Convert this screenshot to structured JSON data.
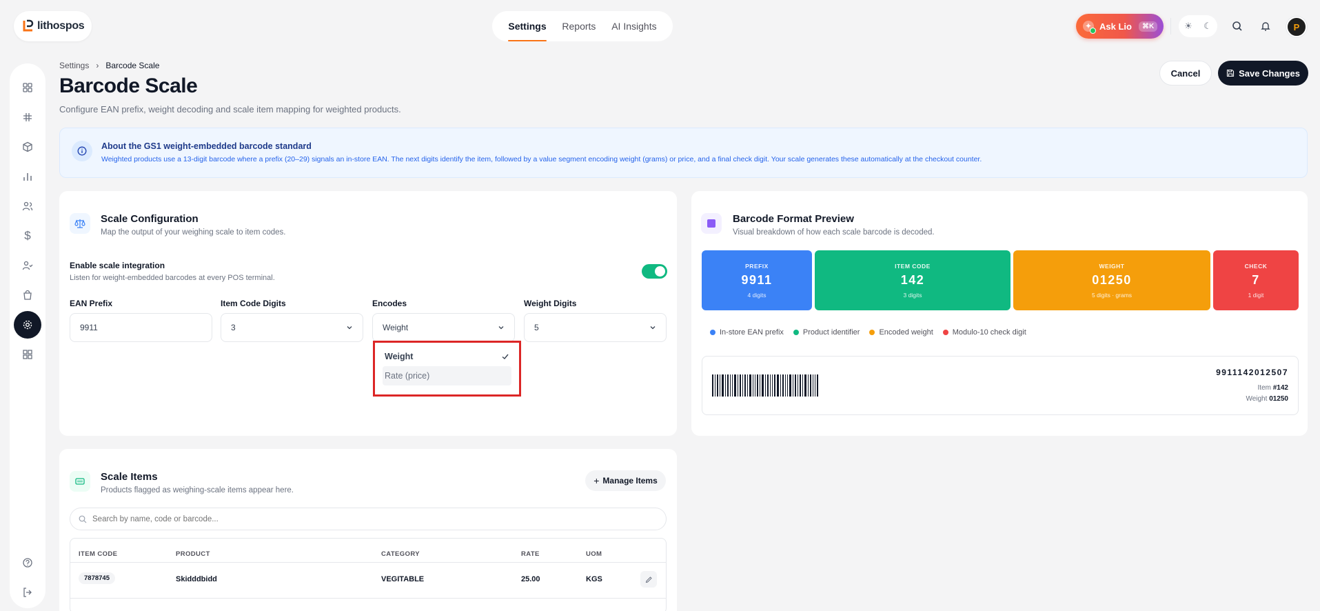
{
  "app": {
    "logo_text": "lithospos"
  },
  "topnav": {
    "tabs": [
      {
        "label": "Settings"
      },
      {
        "label": "Reports"
      },
      {
        "label": "AI Insights"
      }
    ]
  },
  "ask": {
    "label": "Ask Lio",
    "shortcut": "⌘K"
  },
  "user": {
    "avatar_initial": "P"
  },
  "breadcrumb": {
    "parent": "Settings",
    "separator": "›",
    "current": "Barcode Scale"
  },
  "page": {
    "title": "Barcode Scale",
    "subtitle": "Configure EAN prefix, weight decoding and scale item mapping for weighted products."
  },
  "actions": {
    "cancel": "Cancel",
    "save": "Save Changes"
  },
  "banner": {
    "title": "About the GS1 weight-embedded barcode standard",
    "text": "Weighted products use a 13-digit barcode where a prefix (20–29) signals an in-store EAN. The next digits identify the item, followed by a value segment encoding weight (grams) or price, and a final check digit. Your scale generates these automatically at the checkout counter."
  },
  "config": {
    "title": "Scale Configuration",
    "subtitle": "Map the output of your weighing scale to item codes.",
    "enable_label": "Enable scale integration",
    "enable_desc": "Listen for weight-embedded barcodes at every POS terminal.",
    "enabled": true,
    "fields": {
      "ean_prefix": {
        "label": "EAN Prefix",
        "value": "9911"
      },
      "item_code_digits": {
        "label": "Item Code Digits",
        "value": "3"
      },
      "encodes": {
        "label": "Encodes",
        "value": "Weight"
      },
      "weight_digits": {
        "label": "Weight Digits",
        "value": "5"
      }
    },
    "encodes_options": [
      {
        "label": "Weight",
        "selected": true
      },
      {
        "label": "Rate (price)",
        "selected": false
      }
    ]
  },
  "preview": {
    "title": "Barcode Format Preview",
    "subtitle": "Visual breakdown of how each scale barcode is decoded.",
    "segments": [
      {
        "name": "PREFIX",
        "value": "9911",
        "note": "4 digits",
        "color": "#3b82f6"
      },
      {
        "name": "ITEM CODE",
        "value": "142",
        "note": "3 digits",
        "color": "#10b981"
      },
      {
        "name": "WEIGHT",
        "value": "01250",
        "note": "5 digits · grams",
        "color": "#f59e0b"
      },
      {
        "name": "CHECK",
        "value": "7",
        "note": "1 digit",
        "color": "#ef4444"
      }
    ],
    "legend": [
      {
        "label": "In-store EAN prefix",
        "color": "#3b82f6"
      },
      {
        "label": "Product identifier",
        "color": "#10b981"
      },
      {
        "label": "Encoded weight",
        "color": "#f59e0b"
      },
      {
        "label": "Modulo-10 check digit",
        "color": "#ef4444"
      }
    ],
    "barcode_number": "9911142012507",
    "item_label": "Item",
    "item_value": "#142",
    "weight_label": "Weight",
    "weight_value": "01250"
  },
  "items": {
    "title": "Scale Items",
    "subtitle": "Products flagged as weighing-scale items appear here.",
    "manage_label": "Manage Items",
    "search_placeholder": "Search by name, code or barcode...",
    "columns": [
      "ITEM CODE",
      "PRODUCT",
      "CATEGORY",
      "RATE",
      "UOM"
    ],
    "rows": [
      {
        "code": "7878745",
        "product": "Skidddbidd",
        "category": "VEGITABLE",
        "rate": "25.00",
        "uom": "KGS"
      }
    ]
  },
  "colors": {
    "accent": "#f97316",
    "primary_dark": "#111827",
    "toggle_on": "#10b981",
    "highlight_border": "#dc2626"
  }
}
